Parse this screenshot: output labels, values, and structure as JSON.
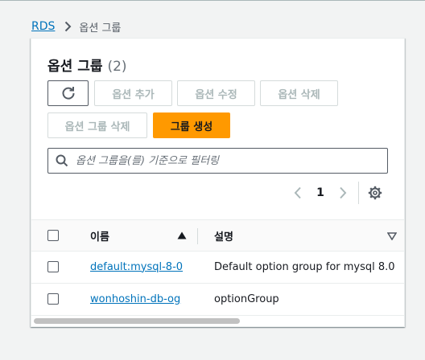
{
  "breadcrumb": {
    "root": "RDS",
    "current": "옵션 그룹"
  },
  "panel": {
    "title": "옵션 그룹",
    "count": "(2)"
  },
  "actions": {
    "add_option": "옵션 추가",
    "edit_option": "옵션 수정",
    "delete_option": "옵션 삭제",
    "delete_group": "옵션 그룹 삭제",
    "create_group": "그룹 생성"
  },
  "search": {
    "placeholder": "옵션 그룹을(를) 기준으로 필터링"
  },
  "pagination": {
    "current_page": "1"
  },
  "table": {
    "columns": [
      "이름",
      "설명"
    ],
    "rows": [
      {
        "name": "default:mysql-8-0",
        "description": "Default option group for mysql 8.0"
      },
      {
        "name": "wonhoshin-db-og",
        "description": "optionGroup"
      }
    ]
  },
  "colors": {
    "primary": "#ff9900",
    "link": "#0073bb",
    "disabled": "#aab7b8"
  },
  "icons": {
    "refresh": "refresh-icon",
    "search": "search-icon",
    "prev": "chevron-left-icon",
    "next": "chevron-right-icon",
    "settings": "gear-icon",
    "sort_asc": "sort-ascending-icon",
    "sort_desc": "sort-descending-icon"
  }
}
